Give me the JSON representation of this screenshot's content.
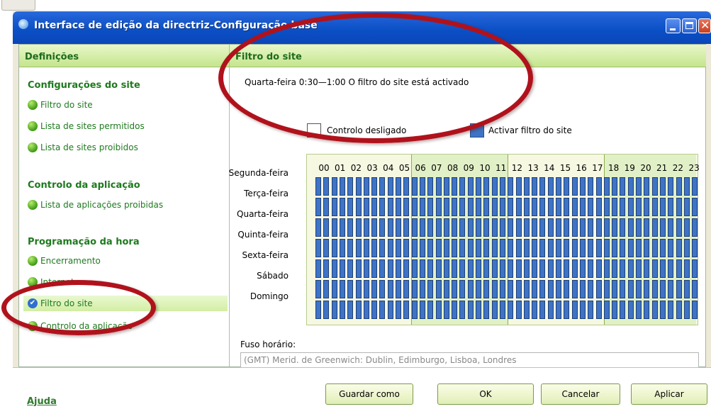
{
  "window": {
    "title": "Interface de edição da directriz-Configuração base"
  },
  "left_panel": {
    "header": "Definições",
    "sections": [
      {
        "title": "Configurações do site",
        "items": [
          "Filtro do site",
          "Lista de sites permitidos",
          "Lista de sites proibidos"
        ]
      },
      {
        "title": "Controlo da aplicação",
        "items": [
          "Lista de aplicações proibidas"
        ]
      },
      {
        "title": "Programação da hora",
        "items": [
          "Encerramento",
          "Internet",
          "Filtro do site",
          "Controlo da aplicação"
        ]
      }
    ],
    "selected_item": "Filtro do site"
  },
  "right_panel": {
    "header": "Filtro do site",
    "status": "Quarta-feira  0:30—1:00  O filtro do site está activado",
    "legend_off": "Controlo desligado",
    "legend_on": "Activar filtro do site",
    "hours": [
      "00",
      "01",
      "02",
      "03",
      "04",
      "05",
      "06",
      "07",
      "08",
      "09",
      "10",
      "11",
      "12",
      "13",
      "14",
      "15",
      "16",
      "17",
      "18",
      "19",
      "20",
      "21",
      "22",
      "23"
    ],
    "days": [
      "Segunda-feira",
      "Terça-feira",
      "Quarta-feira",
      "Quinta-feira",
      "Sexta-feira",
      "Sábado",
      "Domingo"
    ],
    "timezone_label": "Fuso horário:",
    "timezone_value": "(GMT) Merid. de Greenwich: Dublin, Edimburgo, Lisboa, Londres"
  },
  "footer": {
    "help": "Ajuda",
    "save_as": "Guardar como",
    "ok": "OK",
    "cancel": "Cancelar",
    "apply": "Aplicar"
  },
  "colors": {
    "title_bar": "#0b4fc5",
    "accent_green": "#1e7a1e",
    "cell_active": "#3e73c6",
    "highlight_red": "#b0121c"
  }
}
